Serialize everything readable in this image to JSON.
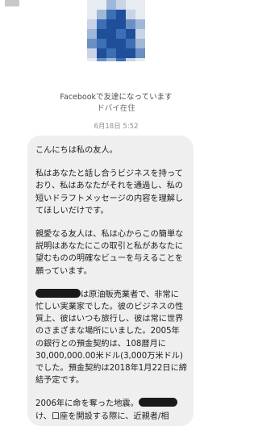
{
  "header": {
    "subtitle": "Facebookで友達になっています",
    "location": "ドバイ在住",
    "timestamp": "6月18日 5:52"
  },
  "avatar": {
    "pixel_colors": [
      "#3d6fb5",
      "#9fb8d8",
      "#1f4f9a",
      "#c9d4e6",
      "#6a8fc3",
      "#e7ebf2"
    ]
  },
  "message": {
    "p1": "こんにちは私の友人。",
    "p2": "私はあなたと話し合うビジネスを持っており、私はあなたがそれを通過し、私の短いドラフトメッセージの内容を理解してほしいだけです。",
    "p3": "親愛なる友人は、私は心からこの簡単な説明はあなたにこの取引と私があなたに望むものの明確なビューを与えることを願っています。",
    "p4_after_redact": "は原油販売業者で、非常に忙しい実業家でした。彼のビジネスの性質上、彼はいつも旅行し、彼は常に世界のさまざまな場所にいました。2005年の銀行との預金契約は、108暦月に30,000,000.00米ドル(3,000万米ドル)でした。預金契約は2018年1月22日に締結予定です。",
    "p5_before_redact": "2006年に命を奪った地震。",
    "p5_cut": "け、口座を開設する際に、近親者/相"
  }
}
